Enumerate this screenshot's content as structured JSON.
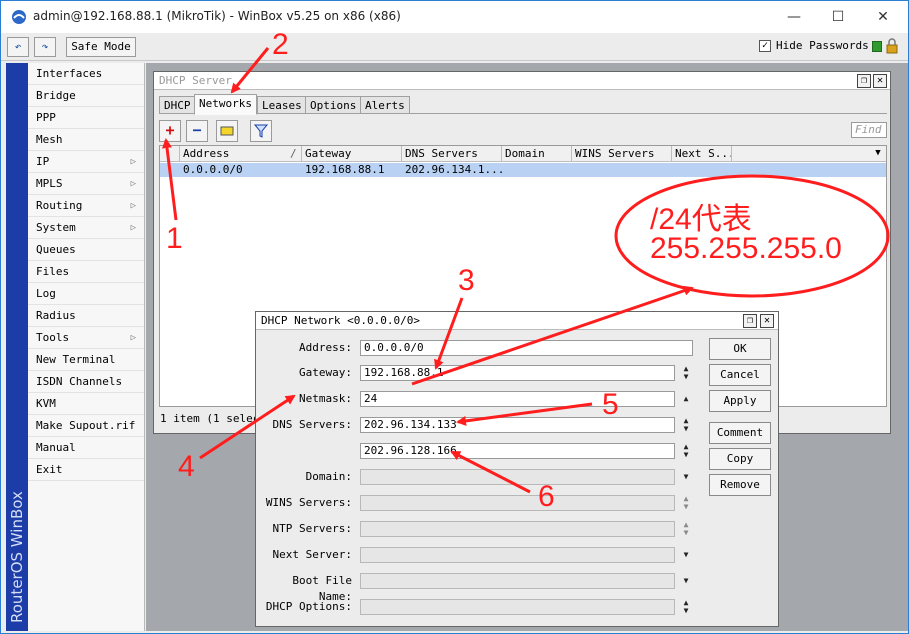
{
  "window": {
    "title": "admin@192.168.88.1 (MikroTik) - WinBox v5.25 on x86 (x86)",
    "minimize": "—",
    "maximize": "☐",
    "close": "✕"
  },
  "toolbar": {
    "undo": "↶",
    "redo": "↷",
    "safe_mode": "Safe Mode",
    "hide_passwords_check": "✓",
    "hide_passwords": "Hide Passwords"
  },
  "sidebar": {
    "brand": "RouterOS WinBox",
    "items": [
      {
        "label": "Interfaces",
        "arrow": ""
      },
      {
        "label": "Bridge",
        "arrow": ""
      },
      {
        "label": "PPP",
        "arrow": ""
      },
      {
        "label": "Mesh",
        "arrow": ""
      },
      {
        "label": "IP",
        "arrow": "▷"
      },
      {
        "label": "MPLS",
        "arrow": "▷"
      },
      {
        "label": "Routing",
        "arrow": "▷"
      },
      {
        "label": "System",
        "arrow": "▷"
      },
      {
        "label": "Queues",
        "arrow": ""
      },
      {
        "label": "Files",
        "arrow": ""
      },
      {
        "label": "Log",
        "arrow": ""
      },
      {
        "label": "Radius",
        "arrow": ""
      },
      {
        "label": "Tools",
        "arrow": "▷"
      },
      {
        "label": "New Terminal",
        "arrow": ""
      },
      {
        "label": "ISDN Channels",
        "arrow": ""
      },
      {
        "label": "KVM",
        "arrow": ""
      },
      {
        "label": "Make Supout.rif",
        "arrow": ""
      },
      {
        "label": "Manual",
        "arrow": ""
      },
      {
        "label": "Exit",
        "arrow": ""
      }
    ]
  },
  "dhcp_server": {
    "title": "DHCP Server",
    "restore": "❐",
    "close": "✕",
    "tabs": [
      "DHCP",
      "Networks",
      "Leases",
      "Options",
      "Alerts"
    ],
    "add": "+",
    "remove": "−",
    "filter": "⊽",
    "find_placeholder": "Find",
    "columns": [
      "Address",
      "Gateway",
      "DNS Servers",
      "Domain",
      "WINS Servers",
      "Next S..."
    ],
    "sort_mark": "/",
    "dropdown": "▼",
    "row": {
      "address": "0.0.0.0/0",
      "gateway": "192.168.88.1",
      "dns": "202.96.134.1..."
    },
    "status": "1 item (1 selec"
  },
  "dhcp_network": {
    "title": "DHCP Network <0.0.0.0/0>",
    "restore": "❐",
    "close": "✕",
    "labels": {
      "address": "Address:",
      "gateway": "Gateway:",
      "netmask": "Netmask:",
      "dns": "DNS Servers:",
      "domain": "Domain:",
      "wins": "WINS Servers:",
      "ntp": "NTP Servers:",
      "next": "Next Server:",
      "boot": "Boot File Name:",
      "options": "DHCP Options:"
    },
    "values": {
      "address": "0.0.0.0/0",
      "gateway": "192.168.88.1",
      "netmask": "24",
      "dns1": "202.96.134.133",
      "dns2": "202.96.128.166"
    },
    "buttons": {
      "ok": "OK",
      "cancel": "Cancel",
      "apply": "Apply",
      "comment": "Comment",
      "copy": "Copy",
      "remove": "Remove"
    },
    "spin_up": "▲",
    "spin_down": "▼"
  },
  "annotations": {
    "n1": "1",
    "n2": "2",
    "n3": "3",
    "n4": "4",
    "n5": "5",
    "n6": "6",
    "callout_line1": "/24代表",
    "callout_line2": "255.255.255.0",
    "color": "#ff1d1d"
  }
}
